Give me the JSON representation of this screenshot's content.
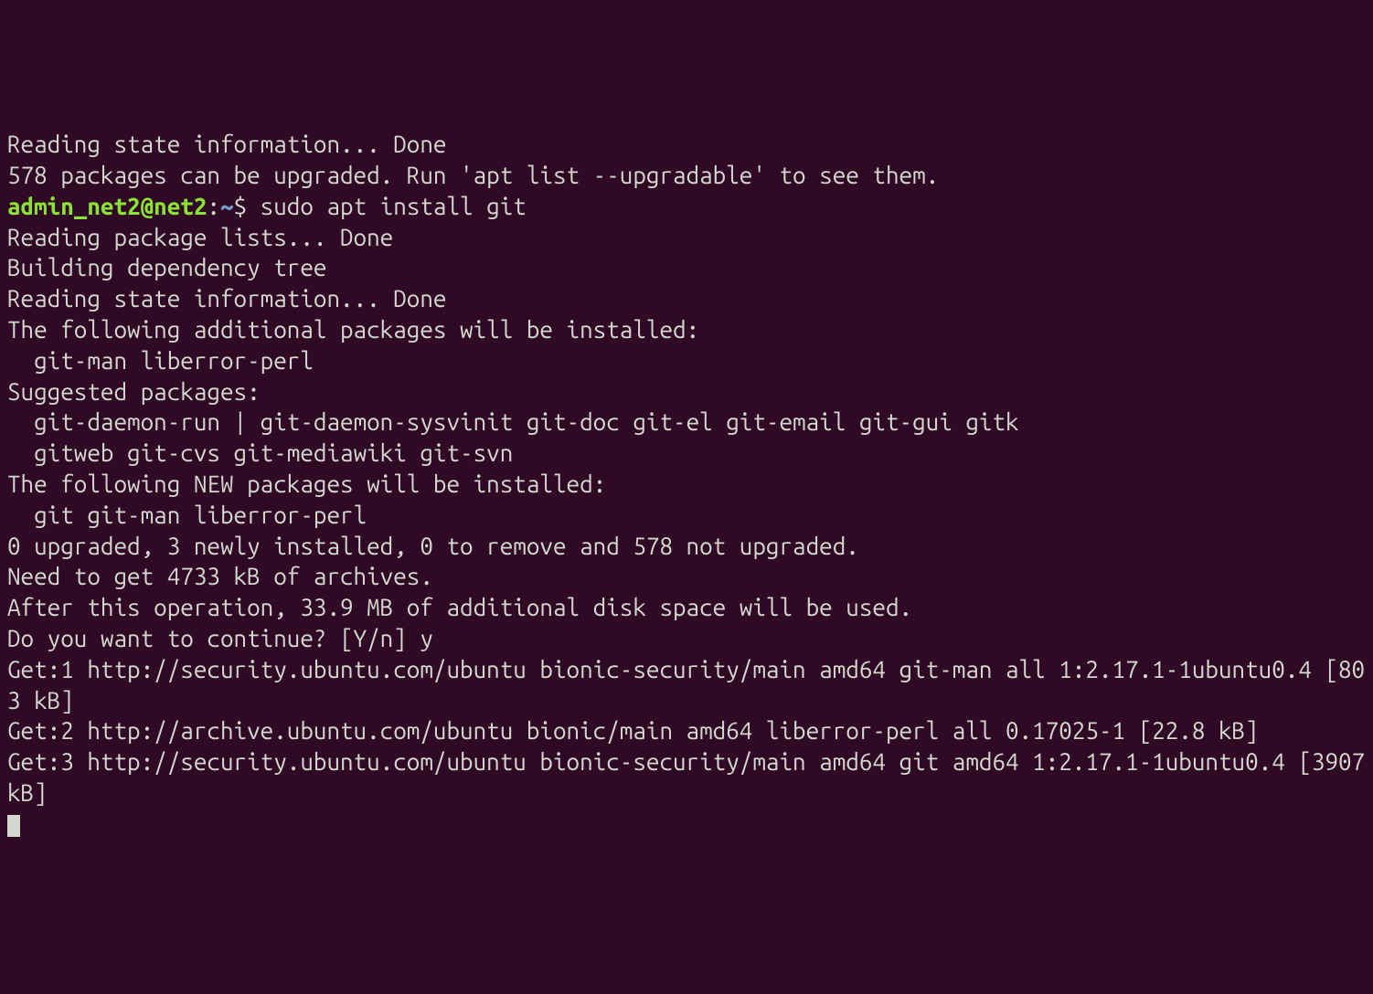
{
  "prompt": {
    "user_host": "admin_net2@net2",
    "colon": ":",
    "path": "~",
    "dollar": "$ ",
    "command": "sudo apt install git"
  },
  "lines": {
    "l1": "Reading state information... Done",
    "l2": "578 packages can be upgraded. Run 'apt list --upgradable' to see them.",
    "l4": "Reading package lists... Done",
    "l5": "Building dependency tree",
    "l6": "Reading state information... Done",
    "l7": "The following additional packages will be installed:",
    "l8": "  git-man liberror-perl",
    "l9": "Suggested packages:",
    "l10": "  git-daemon-run | git-daemon-sysvinit git-doc git-el git-email git-gui gitk",
    "l11": "  gitweb git-cvs git-mediawiki git-svn",
    "l12": "The following NEW packages will be installed:",
    "l13": "  git git-man liberror-perl",
    "l14": "0 upgraded, 3 newly installed, 0 to remove and 578 not upgraded.",
    "l15": "Need to get 4733 kB of archives.",
    "l16": "After this operation, 33.9 MB of additional disk space will be used.",
    "l17": "Do you want to continue? [Y/n] y",
    "l18": "Get:1 http://security.ubuntu.com/ubuntu bionic-security/main amd64 git-man all 1:2.17.1-1ubuntu0.4 [803 kB]",
    "l19": "Get:2 http://archive.ubuntu.com/ubuntu bionic/main amd64 liberror-perl all 0.17025-1 [22.8 kB]",
    "l20": "Get:3 http://security.ubuntu.com/ubuntu bionic-security/main amd64 git amd64 1:2.17.1-1ubuntu0.4 [3907 kB]"
  }
}
